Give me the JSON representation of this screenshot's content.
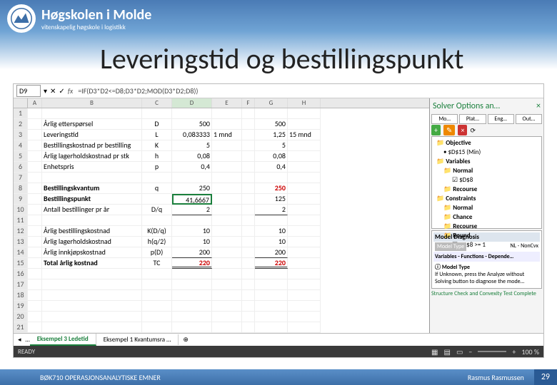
{
  "brand": {
    "name": "Høgskolen i Molde",
    "sub": "vitenskapelig høgskole i logistikk"
  },
  "title": "Leveringstid og bestillingspunkt",
  "cellRef": "D9",
  "formula": "=IF(D3*D2<=D8;D3*D2;MOD(D3*D2;D8))",
  "cols": [
    "A",
    "B",
    "C",
    "D",
    "E",
    "F",
    "G",
    "H"
  ],
  "rows": [
    {
      "n": "1"
    },
    {
      "n": "2",
      "b": "Årlig etterspørsel",
      "c": "D",
      "d": "500",
      "g": "500"
    },
    {
      "n": "3",
      "b": "Leveringstid",
      "c": "L",
      "d": "0,083333",
      "e": "1 mnd",
      "g": "1,25",
      "h": "15 mnd"
    },
    {
      "n": "4",
      "b": "Bestillingskostnad pr bestilling",
      "c": "K",
      "d": "5",
      "g": "5"
    },
    {
      "n": "5",
      "b": "Årlig lagerholdskostnad pr stk",
      "c": "h",
      "d": "0,08",
      "g": "0,08"
    },
    {
      "n": "6",
      "b": "Enhetspris",
      "c": "p",
      "d": "0,4",
      "g": "0,4"
    },
    {
      "n": "7"
    },
    {
      "n": "8",
      "b": "Bestillingskvantum",
      "bold": true,
      "c": "q",
      "d": "250",
      "g": "250",
      "gred": true
    },
    {
      "n": "9",
      "b": "Bestillingspunkt",
      "bold": true,
      "d": "41,6667",
      "sel": true,
      "g": "125"
    },
    {
      "n": "10",
      "b": "Antall bestillinger pr år",
      "c": "D/q",
      "d": "2",
      "g": "2",
      "bb": true
    },
    {
      "n": "11"
    },
    {
      "n": "12",
      "b": "Årlig bestillingskostnad",
      "c": "K(D/q)",
      "d": "10",
      "g": "10"
    },
    {
      "n": "13",
      "b": "Årlig lagerholdskostnad",
      "c": "h(q/2)",
      "d": "10",
      "g": "10"
    },
    {
      "n": "14",
      "b": "Årlig innkjøpskostnad",
      "c": "p(D)",
      "d": "200",
      "g": "200",
      "bb": true
    },
    {
      "n": "15",
      "b": "Total årlig kostnad",
      "bold": true,
      "c": "TC",
      "d": "220",
      "dred": true,
      "g": "220",
      "gred": true,
      "dbl": true
    },
    {
      "n": "16"
    },
    {
      "n": "17"
    },
    {
      "n": "18"
    },
    {
      "n": "19"
    },
    {
      "n": "20"
    },
    {
      "n": "21"
    }
  ],
  "pane": {
    "title": "Solver Options an…",
    "tabs": [
      "Mo…",
      "Plat…",
      "Eng…",
      "Out…"
    ],
    "addLabel": "+",
    "chgLabel": "✎",
    "delLabel": "×",
    "tree": [
      {
        "t": "Objective",
        "f": true
      },
      {
        "t": "$D$15 (Min)",
        "i": 1
      },
      {
        "t": "Variables",
        "f": true
      },
      {
        "t": "Normal",
        "f": true,
        "i": 1
      },
      {
        "t": "$D$8",
        "i": 2,
        "box": true
      },
      {
        "t": "Recourse",
        "f": true,
        "i": 1
      },
      {
        "t": "Constraints",
        "f": true
      },
      {
        "t": "Normal",
        "f": true,
        "i": 1
      },
      {
        "t": "Chance",
        "f": true,
        "i": 1
      },
      {
        "t": "Recourse",
        "f": true,
        "i": 1
      },
      {
        "t": "Bound",
        "f": true,
        "i": 1
      },
      {
        "t": "$D$8 >= 1",
        "i": 2,
        "box": true
      }
    ],
    "diagH": "Model Diagnosis",
    "mt": "Model Type",
    "mtv": "NL - NonCvx",
    "vfd": "Variables - Functions - Depende…",
    "hint1": "Model Type",
    "hint2": "If Unknown, press the Analyze without Solving button to diagnose the mode…",
    "status": "Structure Check and Convexity Test Complete"
  },
  "tabs": {
    "active": "Eksempel 3 Ledetid",
    "other": "Eksempel 1 Kvantumsra …"
  },
  "status": {
    "ready": "READY",
    "zoom": "100 %"
  },
  "footer": {
    "l": "BØK710 OPERASJONSANALYTISKE EMNER",
    "r": "Rasmus Rasmussen",
    "n": "29"
  }
}
